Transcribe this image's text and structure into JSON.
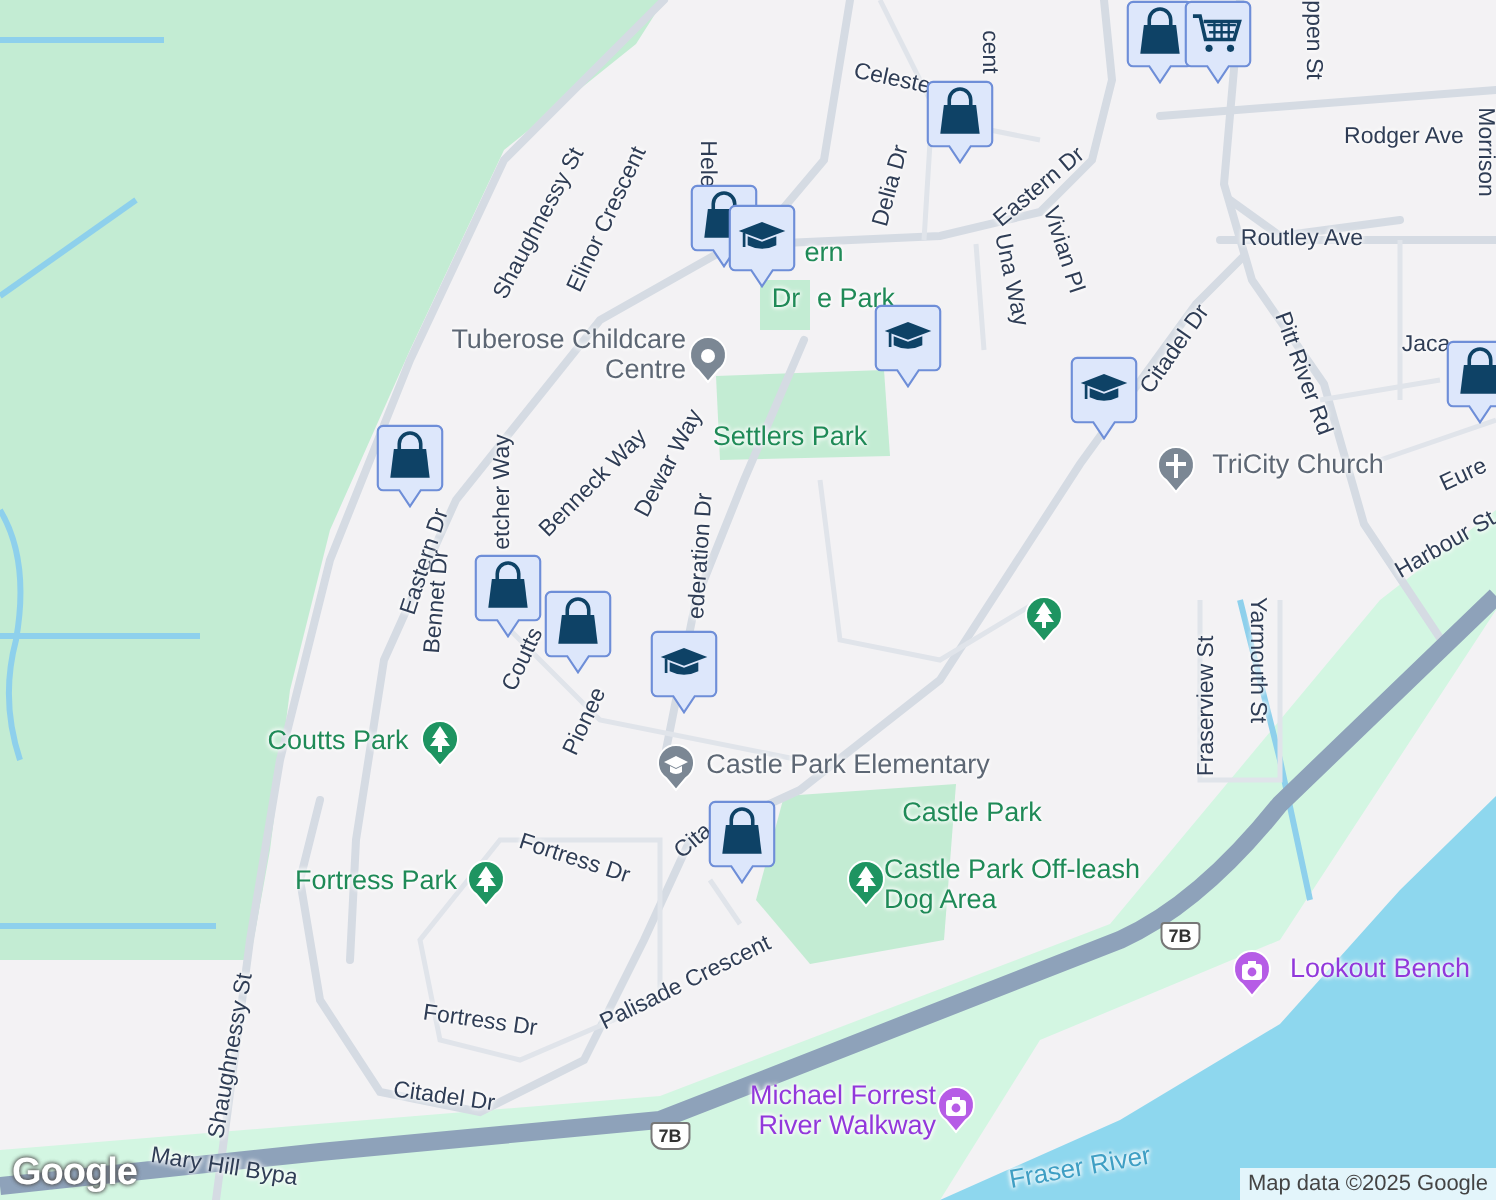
{
  "map": {
    "labels": [
      {
        "text": "Shaughnessy St",
        "kind": "street"
      },
      {
        "text": "Shaughnessy St",
        "kind": "street"
      },
      {
        "text": "Elinor Crescent",
        "kind": "street"
      },
      {
        "text": "Hele",
        "kind": "street"
      },
      {
        "text": "Celeste",
        "kind": "street"
      },
      {
        "text": "cent",
        "kind": "street"
      },
      {
        "text": "Delia Dr",
        "kind": "street"
      },
      {
        "text": "Eastern Dr",
        "kind": "street"
      },
      {
        "text": "Una Way",
        "kind": "street"
      },
      {
        "text": "Vivian Pl",
        "kind": "street"
      },
      {
        "text": "Rodger Ave",
        "kind": "street"
      },
      {
        "text": "Routley Ave",
        "kind": "street"
      },
      {
        "text": "Citadel Dr",
        "kind": "street"
      },
      {
        "text": "Pitt River Rd",
        "kind": "street"
      },
      {
        "text": "Jaca",
        "kind": "street"
      },
      {
        "text": "Eure",
        "kind": "street"
      },
      {
        "text": "Harbour St",
        "kind": "street"
      },
      {
        "text": "Morrison",
        "kind": "street"
      },
      {
        "text": "ppen St",
        "kind": "street"
      },
      {
        "text": "Eastern Dr",
        "kind": "street"
      },
      {
        "text": "Bennet Dr",
        "kind": "street"
      },
      {
        "text": "etcher Way",
        "kind": "street"
      },
      {
        "text": "Benneck Way",
        "kind": "street"
      },
      {
        "text": "Dewar Way",
        "kind": "street"
      },
      {
        "text": "ederation Dr",
        "kind": "street"
      },
      {
        "text": "Coutts",
        "kind": "street"
      },
      {
        "text": "Pionee",
        "kind": "street"
      },
      {
        "text": "Fortress Dr",
        "kind": "street"
      },
      {
        "text": "Fortress Dr",
        "kind": "street"
      },
      {
        "text": "Palisade Crescent",
        "kind": "street"
      },
      {
        "text": "Citadel Dr",
        "kind": "street"
      },
      {
        "text": "Cita",
        "kind": "street"
      },
      {
        "text": "Fraserview St",
        "kind": "street"
      },
      {
        "text": "Yarmouth St",
        "kind": "street"
      },
      {
        "text": "Mary Hill Bypa",
        "kind": "street"
      },
      {
        "text": "ern",
        "kind": "park"
      },
      {
        "text": "Dr",
        "kind": "park"
      },
      {
        "text": "e Park",
        "kind": "park"
      },
      {
        "text": "Settlers Park",
        "kind": "park"
      },
      {
        "text": "Coutts Park",
        "kind": "park"
      },
      {
        "text": "Fortress Park",
        "kind": "park"
      },
      {
        "text": "Castle Park",
        "kind": "park"
      },
      {
        "text": "Castle Park Off-leash Dog Area",
        "kind": "park"
      },
      {
        "text": "Tuberose Childcare Centre",
        "kind": "place"
      },
      {
        "text": "Castle Park Elementary",
        "kind": "place"
      },
      {
        "text": "TriCity Church",
        "kind": "place"
      },
      {
        "text": "7B",
        "kind": "shield"
      },
      {
        "text": "Lookout Bench",
        "kind": "attraction"
      },
      {
        "text": "7B",
        "kind": "shield"
      },
      {
        "text": "Michael Forrest River Walkway",
        "kind": "attraction"
      },
      {
        "text": "Fraser River",
        "kind": "water"
      }
    ],
    "attribution": "Map data ©2025 Google",
    "logo": "Google"
  }
}
